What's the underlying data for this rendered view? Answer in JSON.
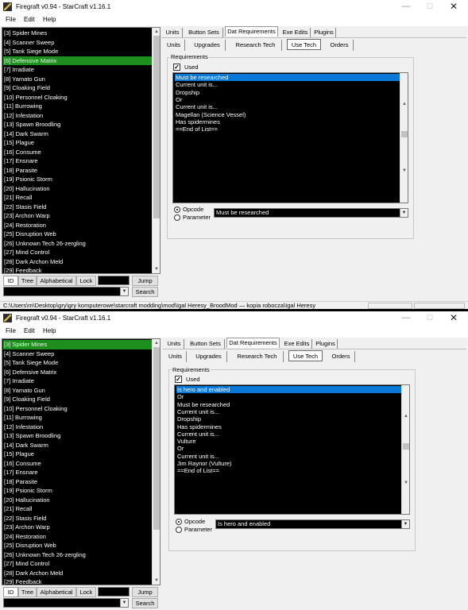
{
  "windows": [
    {
      "title": "Firegraft v0.94 - StarCraft v1.16.1",
      "menu": [
        "File",
        "Edit",
        "Help"
      ],
      "tech_list": [
        "[3] Spider Mines",
        "[4] Scanner Sweep",
        "[5] Tank Siege Mode",
        "[6] Defensive Matrix",
        "[7] Irradiate",
        "[8] Yamato Gun",
        "[9] Cloaking Field",
        "[10] Personnel Cloaking",
        "[11] Burrowing",
        "[12] Infestation",
        "[13] Spawn Broodling",
        "[14] Dark Swarm",
        "[15] Plague",
        "[16] Consume",
        "[17] Ensnare",
        "[18] Parasite",
        "[19] Psionic Storm",
        "[20] Hallucination",
        "[21] Recall",
        "[22] Stasis Field",
        "[23] Archon Warp",
        "[24] Restoration",
        "[25] Disruption Web",
        "[26] Unknown Tech 26-zergling",
        "[27] Mind Control",
        "[28] Dark Archon Meld",
        "[29] Feedback"
      ],
      "selected_index": 3,
      "list_buttons": [
        "ID",
        "Tree",
        "Alphabetical",
        "Lock"
      ],
      "jump_label": "Jump",
      "search_label": "Search",
      "main_tabs": [
        "Units",
        "Button Sets",
        "Dat Requirements",
        "Exe Edits",
        "Plugins"
      ],
      "active_main_tab": 2,
      "sub_tabs": [
        "Units",
        "Upgrades",
        "Research Tech",
        "Use Tech",
        "Orders"
      ],
      "active_sub_tab": 3,
      "requirements_label": "Requirements",
      "used_label": "Used",
      "used_checked": true,
      "requirements": [
        "Must be researched",
        "Current unit is...",
        "Dropship",
        "Or",
        "Current unit is...",
        "Magellan (Science Vessel)",
        "Has spidermines",
        "==End of List=="
      ],
      "selected_requirement": 0,
      "opcode_label": "Opcode",
      "parameter_label": "Parameter",
      "opcode_value": "Must be researched",
      "status_path": "C:\\Users\\m\\Desktop\\gry\\gry komputerowe\\starcraft modding\\mod\\Igal Heresy_BroodMod — kopia robocza\\Igal Heresy"
    },
    {
      "title": "Firegraft v0.94 - StarCraft v1.16.1",
      "menu": [
        "File",
        "Edit",
        "Help"
      ],
      "tech_list": [
        "[3] Spider Mines",
        "[4] Scanner Sweep",
        "[5] Tank Siege Mode",
        "[6] Defensive Matrix",
        "[7] Irradiate",
        "[8] Yamato Gun",
        "[9] Cloaking Field",
        "[10] Personnel Cloaking",
        "[11] Burrowing",
        "[12] Infestation",
        "[13] Spawn Broodling",
        "[14] Dark Swarm",
        "[15] Plague",
        "[16] Consume",
        "[17] Ensnare",
        "[18] Parasite",
        "[19] Psionic Storm",
        "[20] Hallucination",
        "[21] Recall",
        "[22] Stasis Field",
        "[23] Archon Warp",
        "[24] Restoration",
        "[25] Disruption Web",
        "[26] Unknown Tech 26-zergling",
        "[27] Mind Control",
        "[28] Dark Archon Meld",
        "[29] Feedback"
      ],
      "selected_index": 0,
      "list_buttons": [
        "ID",
        "Tree",
        "Alphabetical",
        "Lock"
      ],
      "jump_label": "Jump",
      "search_label": "Search",
      "main_tabs": [
        "Units",
        "Button Sets",
        "Dat Requirements",
        "Exe Edits",
        "Plugins"
      ],
      "active_main_tab": 2,
      "sub_tabs": [
        "Units",
        "Upgrades",
        "Research Tech",
        "Use Tech",
        "Orders"
      ],
      "active_sub_tab": 3,
      "requirements_label": "Requirements",
      "used_label": "Used",
      "used_checked": true,
      "requirements": [
        "Is hero and enabled",
        "Or",
        "Must be researched",
        "Current unit is...",
        "Dropship",
        "Has spidermines",
        "Current unit is...",
        "Vulture",
        "Or",
        "Current unit is...",
        "Jim Raynor (Vulture)",
        "==End of List=="
      ],
      "selected_requirement": 0,
      "opcode_label": "Opcode",
      "parameter_label": "Parameter",
      "opcode_value": "Is hero and enabled"
    }
  ]
}
